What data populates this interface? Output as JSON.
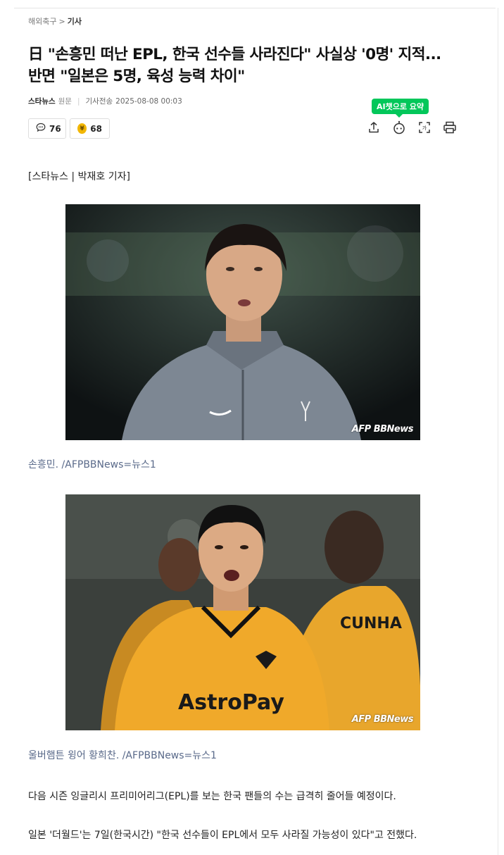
{
  "breadcrumb": {
    "section": "해외축구",
    "separator": ">",
    "current": "기사"
  },
  "article": {
    "title_line1": "日 \"손흥민 떠난 EPL, 한국 선수들 사라진다\" 사실상 '0명' 지적...",
    "title_line2": "반면 \"일본은 5명, 육성 능력 차이\"",
    "press": "스타뉴스",
    "original_label": "원문",
    "sent_label": "기사전송",
    "datetime": "2025-08-08 00:03",
    "byline": "[스타뉴스 | 박재호 기자]"
  },
  "reactions": {
    "comment_count": "76",
    "donate_count": "68",
    "donate_icon_text": "¥"
  },
  "toolbar": {
    "ai_badge_prefix": "AI",
    "ai_badge_label": "챗으로 요약",
    "icons": [
      "share-icon",
      "ai-bot-icon",
      "font-size-icon",
      "print-icon"
    ]
  },
  "photos": [
    {
      "watermark": "AFP BBNews",
      "caption": "손흥민. /AFPBBNews=뉴스1"
    },
    {
      "watermark": "AFP BBNews",
      "caption": "울버햄튼 윙어 황희찬. /AFPBBNews=뉴스1",
      "jersey_name": "CUNHA",
      "sponsor": "AstroPay"
    }
  ],
  "body": {
    "p1": "다음 시즌 잉글리시 프리미어리그(EPL)를 보는 한국 팬들의 수는 급격히 줄어들 예정이다.",
    "p2": "일본 '더월드'는 7일(한국시간) \"한국 선수들이 EPL에서 모두 사라질 가능성이 있다\"고 전했다."
  },
  "colors": {
    "accent_green": "#03c75a",
    "caption_blue": "#5a6a8a",
    "jersey_gold": "#f0a92a"
  }
}
